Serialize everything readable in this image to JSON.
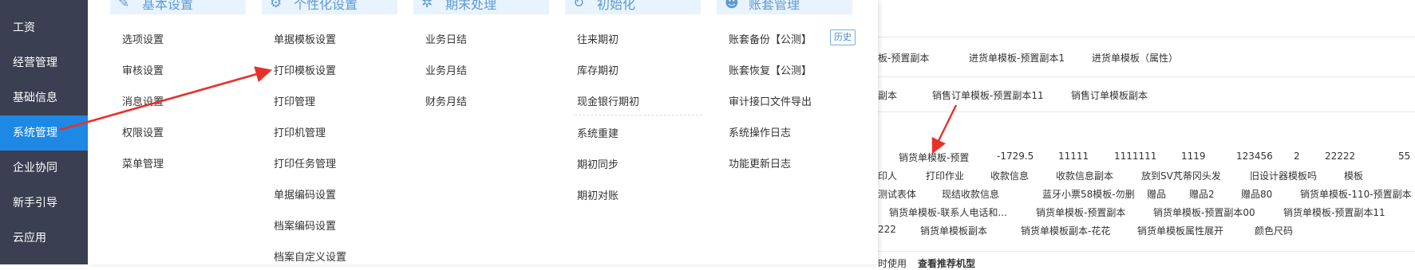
{
  "sidebar": {
    "items": [
      {
        "label": "工资"
      },
      {
        "label": "经营管理"
      },
      {
        "label": "基础信息"
      },
      {
        "label": "系统管理"
      },
      {
        "label": "企业协同"
      },
      {
        "label": "新手引导"
      },
      {
        "label": "云应用"
      }
    ],
    "active_index": 3
  },
  "columns": [
    {
      "title": "基本设置",
      "icon": "wrench-icon",
      "items": [
        "选项设置",
        "审核设置",
        "消息设置",
        "权限设置",
        "菜单管理"
      ]
    },
    {
      "title": "个性化设置",
      "icon": "person-gear-icon",
      "items": [
        "单据模板设置",
        "打印模板设置",
        "打印管理",
        "打印机管理",
        "打印任务管理",
        "单据编码设置",
        "档案编码设置",
        "档案自定义设置"
      ]
    },
    {
      "title": "期末处理",
      "icon": "gear-icon",
      "items": [
        "业务日结",
        "业务月结",
        "财务月结"
      ]
    },
    {
      "title": "初始化",
      "icon": "refresh-icon",
      "items": [
        "往来期初",
        "库存期初",
        "现金银行期初",
        "系统重建",
        "期初同步",
        "期初对账"
      ]
    },
    {
      "title": "账套管理",
      "icon": "person-icon",
      "items": [
        "账套备份【公测】",
        "账套恢复【公测】",
        "审计接口文件导出",
        "系统操作日志",
        "功能更新日志"
      ]
    }
  ],
  "history_badge": "历史",
  "background": {
    "row1": [
      "板-预置副本",
      "进货单模板-预置副本1",
      "进货单模板（属性）"
    ],
    "row2": [
      "副本",
      "销售订单模板-预置副本11",
      "销售订单模板副本"
    ],
    "row3": [
      "销货单模板-预置",
      "-1729.5",
      "11111",
      "1111111",
      "1119",
      "123456",
      "2",
      "22222",
      "55"
    ],
    "row4": [
      "印人",
      "打印作业",
      "收款信息",
      "收款信息副本",
      "放到SV芃蒂冈头发",
      "旧设计器模板吗",
      "模板"
    ],
    "row5": [
      "测试表体",
      "现结收款信息",
      "蓝牙小票58模板-勿删",
      "赠品",
      "赠品2",
      "赠品80",
      "销货单模板-110-预置副本"
    ],
    "row6": [
      "销货单模板-联系人电话和...",
      "销货单模板-预置副本",
      "销货单模板-预置副本00",
      "销货单模板-预置副本11"
    ],
    "row7": [
      "222",
      "销货单模板副本",
      "销货单模板副本-花花",
      "销货单模板属性展开",
      "颜色尺码"
    ],
    "row8": [
      "时使用",
      "查看推荐机型"
    ]
  },
  "colors": {
    "sidebar_bg": "#3a3f51",
    "active_bg": "#1e88e5",
    "accent": "#5b9bd5",
    "arrow": "#e8302a"
  }
}
